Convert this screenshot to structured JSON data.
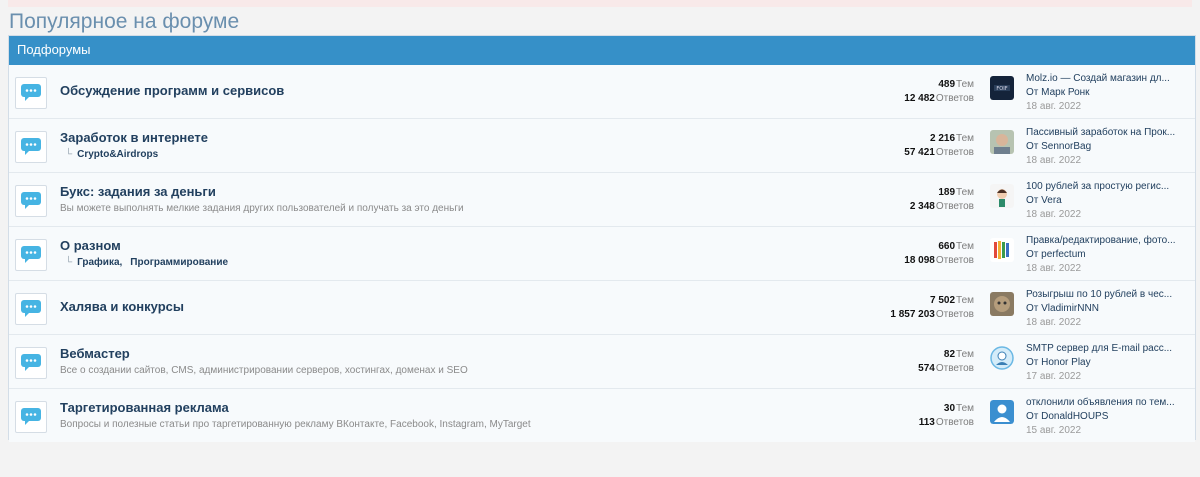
{
  "page": {
    "title": "Популярное на форуме"
  },
  "block": {
    "header": "Подфорумы"
  },
  "colors": {
    "accent": "#3690c8",
    "link": "#22405f",
    "icon_blue": "#46b4e3"
  },
  "forums": [
    {
      "title": "Обсуждение программ и сервисов",
      "desc": "",
      "subforums": [],
      "threads": "489",
      "threads_label": "Тем",
      "posts": "12 482",
      "posts_label": "Ответов",
      "last_title": "Molz.io — Создай магазин дл...",
      "last_by": "От Марк Ронк",
      "last_date": "18 авг. 2022",
      "avatar_icon": "dark-logo-avatar"
    },
    {
      "title": "Заработок в интернете",
      "desc": "",
      "subforums": [
        "Crypto&Airdrops"
      ],
      "threads": "2 216",
      "threads_label": "Тем",
      "posts": "57 421",
      "posts_label": "Ответов",
      "last_title": "Пассивный заработок на Прок...",
      "last_by": "От SennorBag",
      "last_date": "18 авг. 2022",
      "avatar_icon": "photo-person-avatar"
    },
    {
      "title": "Букс: задания за деньги",
      "desc": "Вы можете выполнять мелкие задания других пользователей и получать за это деньги",
      "subforums": [],
      "threads": "189",
      "threads_label": "Тем",
      "posts": "2 348",
      "posts_label": "Ответов",
      "last_title": "100 рублей за простую регис...",
      "last_by": "От Vera",
      "last_date": "18 авг. 2022",
      "avatar_icon": "cartoon-girl-avatar"
    },
    {
      "title": "О разном",
      "desc": "",
      "subforums": [
        "Графика,",
        "Программирование"
      ],
      "threads": "660",
      "threads_label": "Тем",
      "posts": "18 098",
      "posts_label": "Ответов",
      "last_title": "Правка/редактирование, фото...",
      "last_by": "От perfectum",
      "last_date": "18 авг. 2022",
      "avatar_icon": "colorful-stripes-avatar"
    },
    {
      "title": "Халява и конкурсы",
      "desc": "",
      "subforums": [],
      "threads": "7 502",
      "threads_label": "Тем",
      "posts": "1 857 203",
      "posts_label": "Ответов",
      "last_title": "Розыгрыш по 10 рублей в чес...",
      "last_by": "От VladimirNNN",
      "last_date": "18 авг. 2022",
      "avatar_icon": "monkey-photo-avatar"
    },
    {
      "title": "Вебмастер",
      "desc": "Все о создании сайтов, CMS, администрировании серверов, хостингах, доменах и SEO",
      "subforums": [],
      "threads": "82",
      "threads_label": "Тем",
      "posts": "574",
      "posts_label": "Ответов",
      "last_title": "SMTP сервер для E-mail расс...",
      "last_by": "От Honor Play",
      "last_date": "17 авг. 2022",
      "avatar_icon": "person-circle-avatar"
    },
    {
      "title": "Таргетированная реклама",
      "desc": "Вопросы и полезные статьи про таргетированную рекламу ВКонтакте, Facebook, Instagram, MyTarget",
      "subforums": [],
      "threads": "30",
      "threads_label": "Тем",
      "posts": "113",
      "posts_label": "Ответов",
      "last_title": "отклонили объявления по тем...",
      "last_by": "От DonaldHOUPS",
      "last_date": "15 авг. 2022",
      "avatar_icon": "default-user-avatar"
    }
  ]
}
